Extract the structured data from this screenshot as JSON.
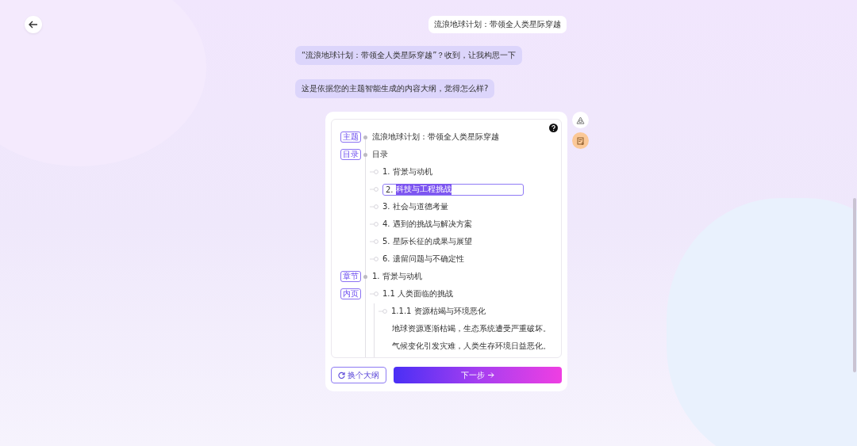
{
  "messages": [
    {
      "kind": "user",
      "text": "流浪地球计划：带领全人类星际穿越"
    },
    {
      "kind": "assistant",
      "text": "“流浪地球计划：带领全人类星际穿越”？收到，让我构思一下"
    },
    {
      "kind": "assistant",
      "text": "这是依据您的主题智能生成的内容大纲，觉得怎么样?"
    }
  ],
  "outline": [
    {
      "tag": "主题",
      "text": "流浪地球计划：带领全人类星际穿越"
    },
    {
      "tag": "目录",
      "text": "目录",
      "children": [
        {
          "number": "1.",
          "text": "背景与动机",
          "editing": false
        },
        {
          "number": "2.",
          "text": "科技与工程挑战",
          "editing": true
        },
        {
          "number": "3.",
          "text": "社会与道德考量",
          "editing": false
        },
        {
          "number": "4.",
          "text": "遇到的挑战与解决方案",
          "editing": false
        },
        {
          "number": "5.",
          "text": "星际长征的成果与展望",
          "editing": false
        },
        {
          "number": "6.",
          "text": "遗留问题与不确定性",
          "editing": false
        }
      ]
    },
    {
      "tag": "章节",
      "number": "1.",
      "text": "背景与动机",
      "children": [
        {
          "tag": "内页",
          "number": "1.1",
          "text": "人类面临的挑战",
          "children": [
            {
              "number": "1.1.1",
              "text": "资源枯竭与环境恶化",
              "children": [
                {
                  "text": "地球资源逐渐枯竭，生态系统遭受严重破坏。"
                },
                {
                  "text": "气候变化引发灾难，人类生存环境日益恶化。"
                }
              ]
            }
          ]
        }
      ]
    }
  ],
  "buttons": {
    "secondary": "换个大纲",
    "primary": "下一步"
  }
}
